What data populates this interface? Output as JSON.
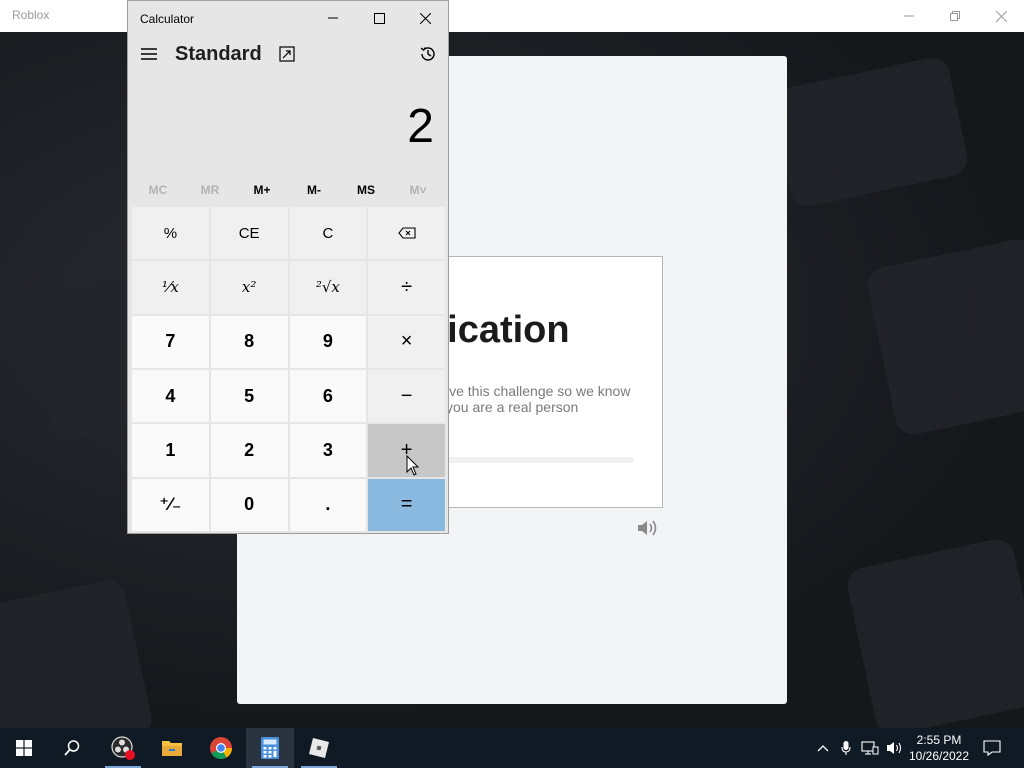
{
  "roblox": {
    "window_title": "Roblox"
  },
  "verification": {
    "heading": "erification",
    "line1": "lve this challenge so we know",
    "line2": "you are a real person"
  },
  "calculator": {
    "window_title": "Calculator",
    "mode": "Standard",
    "display": "2",
    "memory": [
      {
        "label": "MC",
        "enabled": false
      },
      {
        "label": "MR",
        "enabled": false
      },
      {
        "label": "M+",
        "enabled": true
      },
      {
        "label": "M-",
        "enabled": true
      },
      {
        "label": "MS",
        "enabled": true
      },
      {
        "label": "M˅",
        "enabled": false
      }
    ],
    "keys": {
      "percent": "%",
      "ce": "CE",
      "c": "C",
      "reciprocal": "¹⁄x",
      "square": "x²",
      "sqrt": "²√x",
      "divide": "÷",
      "seven": "7",
      "eight": "8",
      "nine": "9",
      "multiply": "×",
      "four": "4",
      "five": "5",
      "six": "6",
      "minus": "−",
      "one": "1",
      "two": "2",
      "three": "3",
      "plus": "+",
      "negate": "⁺∕₋",
      "zero": "0",
      "decimal": ".",
      "equals": "="
    }
  },
  "taskbar": {
    "time": "2:55 PM",
    "date": "10/26/2022"
  }
}
